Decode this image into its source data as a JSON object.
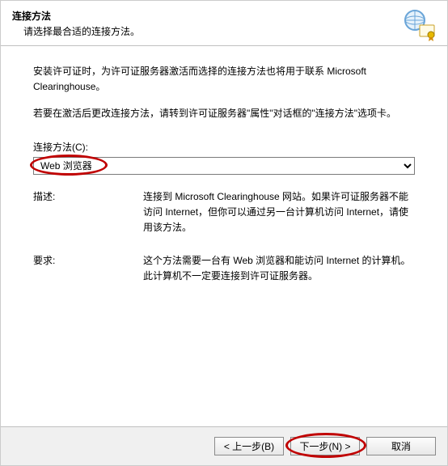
{
  "header": {
    "title": "连接方法",
    "subtitle": "请选择最合适的连接方法。"
  },
  "content": {
    "intro": "安装许可证时，为许可证服务器激活而选择的连接方法也将用于联系 Microsoft Clearinghouse。",
    "note": "若要在激活后更改连接方法，请转到许可证服务器\"属性\"对话框的\"连接方法\"选项卡。",
    "method_label": "连接方法(C):",
    "method_value": "Web 浏览器",
    "desc_label": "描述:",
    "desc_value": "连接到 Microsoft Clearinghouse 网站。如果许可证服务器不能访问 Internet，但你可以通过另一台计算机访问 Internet，请使用该方法。",
    "req_label": "要求:",
    "req_value": "这个方法需要一台有 Web 浏览器和能访问 Internet 的计算机。此计算机不一定要连接到许可证服务器。"
  },
  "footer": {
    "back": "< 上一步(B)",
    "next": "下一步(N) >",
    "cancel": "取消"
  }
}
